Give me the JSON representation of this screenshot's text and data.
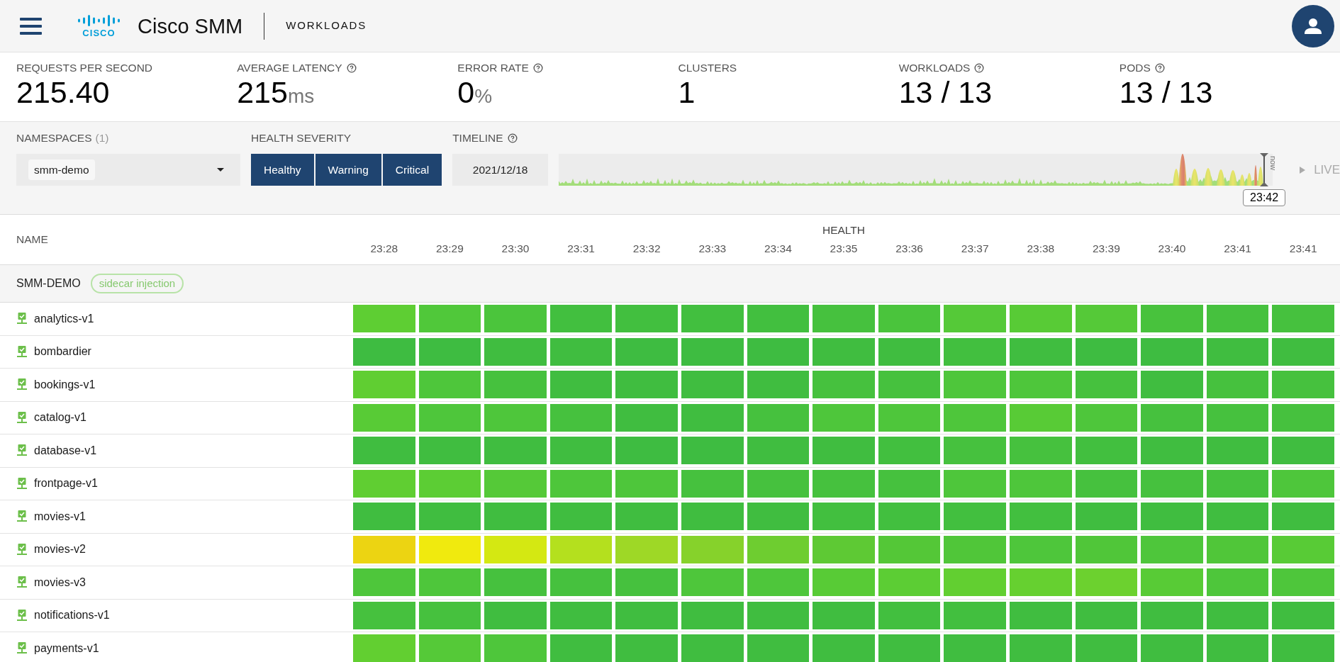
{
  "header": {
    "logo_text": "CISCO",
    "app_title": "Cisco SMM",
    "page_title": "WORKLOADS"
  },
  "metrics": [
    {
      "label": "REQUESTS PER SECOND",
      "help": false,
      "value": "215.40"
    },
    {
      "label": "AVERAGE LATENCY",
      "help": true,
      "value": "215",
      "unit": "ms"
    },
    {
      "label": "ERROR RATE",
      "help": true,
      "value": "0",
      "unit": "%"
    },
    {
      "label": "CLUSTERS",
      "help": false,
      "value": "1"
    },
    {
      "label": "WORKLOADS",
      "help": true,
      "value": "13 / 13"
    },
    {
      "label": "PODS",
      "help": true,
      "value": "13 / 13"
    }
  ],
  "filters": {
    "namespaces": {
      "label": "NAMESPACES",
      "count": "(1)",
      "chip": "smm-demo"
    },
    "health_severity": {
      "label": "HEALTH SEVERITY",
      "options": [
        {
          "label": "Healthy",
          "selected": true
        },
        {
          "label": "Warning",
          "selected": true
        },
        {
          "label": "Critical",
          "selected": true
        }
      ]
    },
    "timeline": {
      "label": "TIMELINE",
      "help": true,
      "date": "2021/12/18",
      "now_label": "now",
      "cursor_time": "23:42",
      "live_label": "LIVE"
    }
  },
  "table": {
    "name_heading": "NAME",
    "health_heading": "HEALTH",
    "times": [
      "23:28",
      "23:29",
      "23:30",
      "23:31",
      "23:32",
      "23:33",
      "23:34",
      "23:35",
      "23:36",
      "23:37",
      "23:38",
      "23:39",
      "23:40",
      "23:41",
      "23:41"
    ],
    "group": {
      "name": "SMM-DEMO",
      "tag": "sidecar injection"
    },
    "rows": [
      {
        "name": "analytics-v1",
        "cells": [
          {
            "color": "#5ece33"
          },
          {
            "color": "#50c83a"
          },
          {
            "color": "#4bc53c"
          },
          {
            "color": "#42bf3f"
          },
          {
            "color": "#42bf3f"
          },
          {
            "color": "#42bf3f"
          },
          {
            "color": "#42bf3f"
          },
          {
            "color": "#46c13e"
          },
          {
            "color": "#4ac43c"
          },
          {
            "color": "#55c938"
          },
          {
            "color": "#58cb36"
          },
          {
            "color": "#55c938"
          },
          {
            "color": "#48c23d"
          },
          {
            "color": "#46c13e"
          },
          {
            "color": "#46c13e"
          }
        ]
      },
      {
        "name": "bombardier",
        "cells": [
          {
            "color": "#3ebc41"
          },
          {
            "color": "#3ebc41"
          },
          {
            "color": "#40bd40"
          },
          {
            "color": "#40bd40"
          },
          {
            "color": "#3ebc41"
          },
          {
            "color": "#3ebc41"
          },
          {
            "color": "#3ebc41"
          },
          {
            "color": "#40bd40"
          },
          {
            "color": "#40bd40"
          },
          {
            "color": "#42bf3f"
          },
          {
            "color": "#40bd40"
          },
          {
            "color": "#3ebc41"
          },
          {
            "color": "#3ebc41"
          },
          {
            "color": "#40bd40"
          },
          {
            "color": "#40bd40"
          }
        ]
      },
      {
        "name": "bookings-v1",
        "cells": [
          {
            "color": "#60ce32"
          },
          {
            "color": "#4ec63b"
          },
          {
            "color": "#46c13e"
          },
          {
            "color": "#40bd40"
          },
          {
            "color": "#40bd40"
          },
          {
            "color": "#40bd40"
          },
          {
            "color": "#40bd40"
          },
          {
            "color": "#46c13e"
          },
          {
            "color": "#46c13e"
          },
          {
            "color": "#4ec63b"
          },
          {
            "color": "#4ec63b"
          },
          {
            "color": "#46c13e"
          },
          {
            "color": "#40bd40"
          },
          {
            "color": "#46c13e"
          },
          {
            "color": "#46c13e"
          }
        ]
      },
      {
        "name": "catalog-v1",
        "cells": [
          {
            "color": "#58cb36"
          },
          {
            "color": "#4ec63b"
          },
          {
            "color": "#4ec63b"
          },
          {
            "color": "#46c13e"
          },
          {
            "color": "#40bd40"
          },
          {
            "color": "#40bd40"
          },
          {
            "color": "#46c13e"
          },
          {
            "color": "#4ec63b"
          },
          {
            "color": "#4ec63b"
          },
          {
            "color": "#4ec63b"
          },
          {
            "color": "#58cb36"
          },
          {
            "color": "#4ec63b"
          },
          {
            "color": "#46c13e"
          },
          {
            "color": "#46c13e"
          },
          {
            "color": "#46c13e"
          }
        ]
      },
      {
        "name": "database-v1",
        "cells": [
          {
            "color": "#40bd40"
          },
          {
            "color": "#40bd40"
          },
          {
            "color": "#40bd40"
          },
          {
            "color": "#40bd40"
          },
          {
            "color": "#3ebc41"
          },
          {
            "color": "#3ebc41"
          },
          {
            "color": "#40bd40"
          },
          {
            "color": "#40bd40"
          },
          {
            "color": "#42bf3f"
          },
          {
            "color": "#46c13e"
          },
          {
            "color": "#46c13e"
          },
          {
            "color": "#42bf3f"
          },
          {
            "color": "#40bd40"
          },
          {
            "color": "#40bd40"
          },
          {
            "color": "#40bd40"
          }
        ]
      },
      {
        "name": "frontpage-v1",
        "cells": [
          {
            "color": "#60ce32"
          },
          {
            "color": "#5ccd34"
          },
          {
            "color": "#55c938"
          },
          {
            "color": "#4ec63b"
          },
          {
            "color": "#4ec63b"
          },
          {
            "color": "#46c13e"
          },
          {
            "color": "#46c13e"
          },
          {
            "color": "#46c13e"
          },
          {
            "color": "#46c13e"
          },
          {
            "color": "#4ec63b"
          },
          {
            "color": "#4ec63b"
          },
          {
            "color": "#46c13e"
          },
          {
            "color": "#46c13e"
          },
          {
            "color": "#46c13e"
          },
          {
            "color": "#4ec63b"
          }
        ]
      },
      {
        "name": "movies-v1",
        "cells": [
          {
            "color": "#40bd40"
          },
          {
            "color": "#40bd40"
          },
          {
            "color": "#40bd40"
          },
          {
            "color": "#40bd40"
          },
          {
            "color": "#40bd40"
          },
          {
            "color": "#40bd40"
          },
          {
            "color": "#40bd40"
          },
          {
            "color": "#42bf3f"
          },
          {
            "color": "#42bf3f"
          },
          {
            "color": "#42bf3f"
          },
          {
            "color": "#42bf3f"
          },
          {
            "color": "#40bd40"
          },
          {
            "color": "#40bd40"
          },
          {
            "color": "#40bd40"
          },
          {
            "color": "#40bd40"
          }
        ]
      },
      {
        "name": "movies-v2",
        "cells": [
          {
            "color": "#ecd412"
          },
          {
            "color": "#f0ea0e"
          },
          {
            "color": "#d4e812"
          },
          {
            "color": "#b4e01e"
          },
          {
            "color": "#9ed826"
          },
          {
            "color": "#86d22b"
          },
          {
            "color": "#6ecd30"
          },
          {
            "color": "#5ec934"
          },
          {
            "color": "#54c737"
          },
          {
            "color": "#50c639"
          },
          {
            "color": "#4ec63b"
          },
          {
            "color": "#50c639"
          },
          {
            "color": "#4ec63b"
          },
          {
            "color": "#50c639"
          },
          {
            "color": "#58cb36"
          }
        ]
      },
      {
        "name": "movies-v3",
        "cells": [
          {
            "color": "#4ec63b"
          },
          {
            "color": "#4ec63b"
          },
          {
            "color": "#46c13e"
          },
          {
            "color": "#46c13e"
          },
          {
            "color": "#46c13e"
          },
          {
            "color": "#4ec63b"
          },
          {
            "color": "#4ec63b"
          },
          {
            "color": "#58cb36"
          },
          {
            "color": "#5ccd34"
          },
          {
            "color": "#62cf31"
          },
          {
            "color": "#66d030"
          },
          {
            "color": "#6cd12f"
          },
          {
            "color": "#58cb36"
          },
          {
            "color": "#4ec63b"
          },
          {
            "color": "#4ec63b"
          }
        ]
      },
      {
        "name": "notifications-v1",
        "cells": [
          {
            "color": "#46c13e"
          },
          {
            "color": "#46c13e"
          },
          {
            "color": "#40bd40"
          },
          {
            "color": "#40bd40"
          },
          {
            "color": "#40bd40"
          },
          {
            "color": "#40bd40"
          },
          {
            "color": "#40bd40"
          },
          {
            "color": "#40bd40"
          },
          {
            "color": "#42bf3f"
          },
          {
            "color": "#42bf3f"
          },
          {
            "color": "#40bd40"
          },
          {
            "color": "#40bd40"
          },
          {
            "color": "#40bd40"
          },
          {
            "color": "#40bd40"
          },
          {
            "color": "#40bd40"
          }
        ]
      },
      {
        "name": "payments-v1",
        "cells": [
          {
            "color": "#62cf31"
          },
          {
            "color": "#55c938"
          },
          {
            "color": "#4ec63b"
          },
          {
            "color": "#40bd40"
          },
          {
            "color": "#40bd40"
          },
          {
            "color": "#40bd40"
          },
          {
            "color": "#40bd40"
          },
          {
            "color": "#40bd40"
          },
          {
            "color": "#40bd40"
          },
          {
            "color": "#40bd40"
          },
          {
            "color": "#40bd40"
          },
          {
            "color": "#40bd40"
          },
          {
            "color": "#40bd40"
          },
          {
            "color": "#40bd40"
          },
          {
            "color": "#40bd40"
          }
        ]
      }
    ]
  }
}
